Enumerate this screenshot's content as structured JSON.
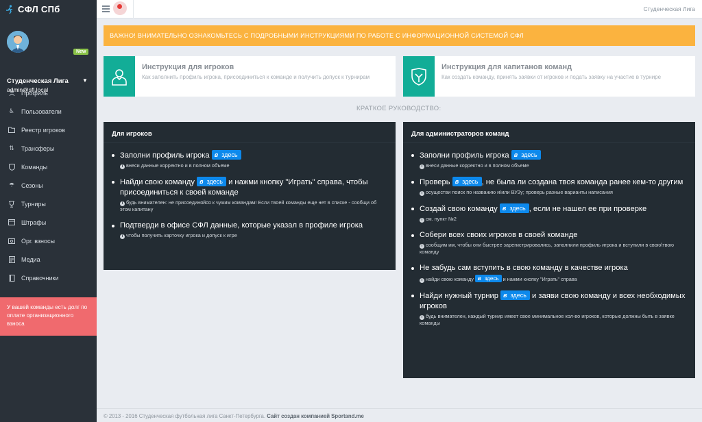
{
  "brand": {
    "title": "СФЛ СПб"
  },
  "profile": {
    "badge": "New",
    "name": "Студенческая Лига",
    "email": "admin@sfl.local"
  },
  "menu": [
    {
      "label": "Профиль",
      "icon": "user-icon"
    },
    {
      "label": "Пользователи",
      "icon": "accessibility-icon"
    },
    {
      "label": "Реестр игроков",
      "icon": "folder-icon"
    },
    {
      "label": "Трансферы",
      "icon": "transfer-icon"
    },
    {
      "label": "Команды",
      "icon": "shield-icon"
    },
    {
      "label": "Сезоны",
      "icon": "umbrella-icon"
    },
    {
      "label": "Турниры",
      "icon": "trophy-icon"
    },
    {
      "label": "Штрафы",
      "icon": "fines-icon"
    },
    {
      "label": "Орг. взносы",
      "icon": "money-icon"
    },
    {
      "label": "Медиа",
      "icon": "media-icon"
    },
    {
      "label": "Справочники",
      "icon": "book-icon"
    }
  ],
  "debt_notice": "У вашей команды есть долг по оплате организационного взноса",
  "topbar": {
    "user": "Студенческая Лига"
  },
  "alert": "ВАЖНО! ВНИМАТЕЛЬНО ОЗНАКОМЬТЕСЬ С ПОДРОБНЫМИ ИНСТРУКЦИЯМИ ПО РАБОТЕ С ИНФОРМАЦИОННОЙ СИСТЕМОЙ СФЛ",
  "cards": {
    "players": {
      "title": "Инструкция для игроков",
      "desc": "Как заполнить профиль игрока, присоединиться к команде и получить допуск к турнирам"
    },
    "captains": {
      "title": "Инструкция для капитанов команд",
      "desc": "Как создать команду, принять заявки от игроков и подать заявку на участие в турнире"
    }
  },
  "guide_title": "КРАТКОЕ РУКОВОДСТВО:",
  "here_label": "здесь",
  "players_panel": {
    "title": "Для игроков",
    "s1": {
      "text": "Заполни профиль игрока",
      "note": "внеси данные корректно и в полном объеме"
    },
    "s2": {
      "pre": "Найди свою команду",
      "post": "и нажми кнопку \"Играть\" справа, чтобы присоединиться к своей команде",
      "note": "будь внимателен: не присоединяйся к чужим командам! Если твоей команды еще нет в списке - сообщи об этом капитану"
    },
    "s3": {
      "text": "Подтверди в офисе СФЛ данные, которые указал в профиле игрока",
      "note": "чтобы получить карточку игрока и допуск к игре"
    }
  },
  "admins_panel": {
    "title": "Для администраторов команд",
    "s1": {
      "text": "Заполни профиль игрока",
      "note": "внеси данные корректно и в полном объеме"
    },
    "s2": {
      "pre": "Проверь",
      "post": ", не была ли создана твоя команда ранее кем-то другим",
      "note": "осуществи поиск по названию и\\или ВУЗу; проверь разные варианты написания"
    },
    "s3": {
      "pre": "Создай свою команду",
      "post": ", если не нашел ее при проверке",
      "note": "см. пункт №2"
    },
    "s4": {
      "text": "Собери всех своих игроков в своей команде",
      "note": "сообщим им, чтобы они быстрее зарегистрировались, заполнили профиль игрока и вступили в свою\\твою команду"
    },
    "s5": {
      "text": "Не забудь сам вступить в свою команду в качестве игрока",
      "note_pre": "найди свою команду",
      "note_post": "и нажми кнопку \"Играть\" справа"
    },
    "s6": {
      "pre": "Найди нужный турнир",
      "post": "и заяви свою команду и всех необходимых игроков",
      "note": "будь внимателен, каждый турнир имеет свое минимальное кол-во игроков, которые должны быть в заявке команды"
    }
  },
  "footer": {
    "copy": "© 2013 - 2016 Студенческая футбольная лига Санкт-Петербурга.",
    "credit": "Сайт создан компанией Sportand.me"
  }
}
